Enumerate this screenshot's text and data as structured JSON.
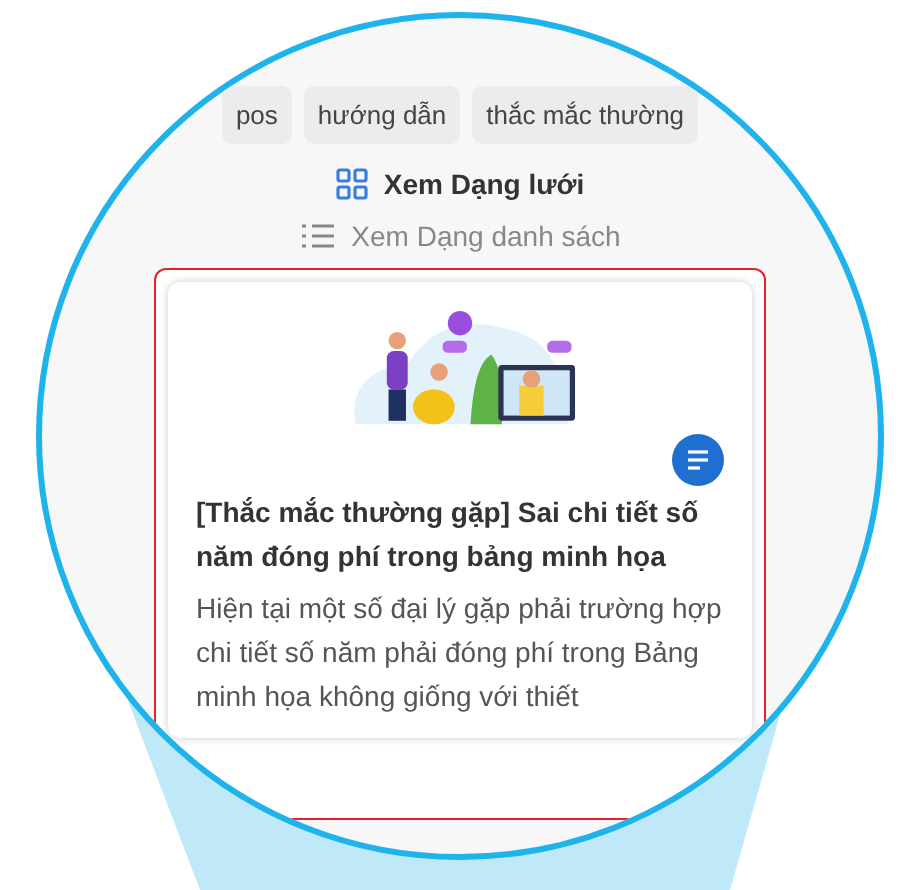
{
  "tags": [
    {
      "label": "pos"
    },
    {
      "label": "hướng dẫn"
    },
    {
      "label": "thắc mắc thường"
    }
  ],
  "view_options": [
    {
      "kind": "grid",
      "label": "Xem Dạng lưới",
      "selected": true
    },
    {
      "kind": "list",
      "label": "Xem Dạng danh sách",
      "selected": false
    }
  ],
  "article_card": {
    "title": "[Thắc mắc thường gặp] Sai chi tiết số năm đóng phí trong bảng minh họa",
    "excerpt": "Hiện tại một số đại lý gặp phải trường hợp chi tiết số năm phải đóng phí trong Bảng minh họa không giống với thiết"
  }
}
